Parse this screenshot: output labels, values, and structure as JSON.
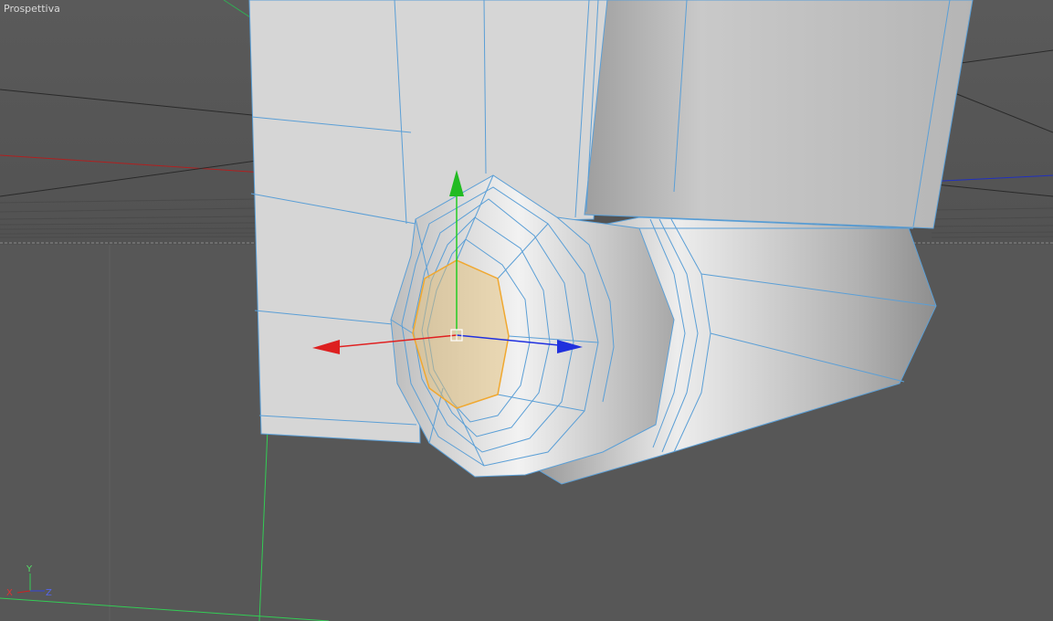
{
  "viewport": {
    "label": "Prospettiva",
    "colors": {
      "background": "#575757",
      "horizon": "#5e5e5e",
      "model_face": "#d9d9d9",
      "wire": "#5b9fd6",
      "selection": "#f0a830",
      "axis_x": "#e02020",
      "axis_y": "#20c020",
      "axis_z": "#2030e0"
    }
  },
  "axis_indicator": {
    "y_label": "Y",
    "x_label": "X",
    "z_label": "Z"
  }
}
